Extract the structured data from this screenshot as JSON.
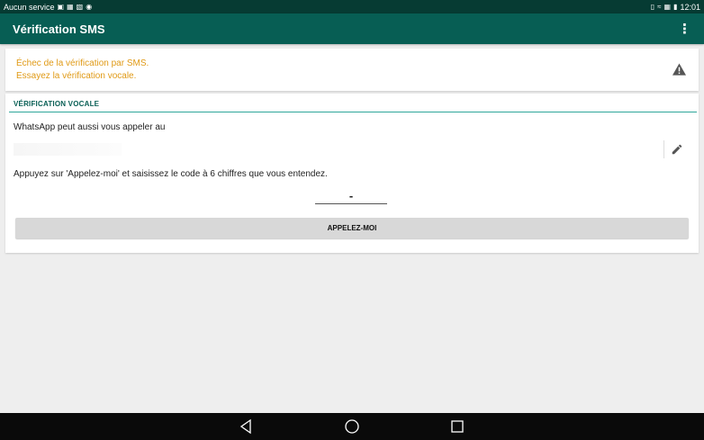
{
  "status_bar": {
    "carrier": "Aucun service",
    "time": "12:01",
    "left_icons": [
      "sim-icon",
      "image-icon",
      "download-icon",
      "camera-icon"
    ],
    "right_icons": [
      "vibrate-icon",
      "wifi-icon",
      "battery-saver-icon",
      "battery-icon"
    ]
  },
  "app_bar": {
    "title": "Vérification SMS",
    "menu_icon": "overflow-menu-icon"
  },
  "warning": {
    "line1": "Échec de la vérification par SMS.",
    "line2": "Essayez la vérification vocale.",
    "icon": "warning-icon",
    "color": "#e09a16"
  },
  "voice_section": {
    "title": "VÉRIFICATION VOCALE",
    "intro": "WhatsApp peut aussi vous appeler au",
    "edit_icon": "pencil-icon",
    "instruction": "Appuyez sur 'Appelez-moi' et saisissez le code à 6 chiffres que vous entendez.",
    "code_value": "-",
    "button_label": "APPELEZ-MOI"
  },
  "nav_bar": {
    "icons": [
      "back-icon",
      "home-icon",
      "recent-apps-icon"
    ]
  },
  "colors": {
    "app_bar": "#075e54",
    "status_bar": "#063b33",
    "accent_line": "#2fa79a",
    "background": "#eeeeee"
  }
}
